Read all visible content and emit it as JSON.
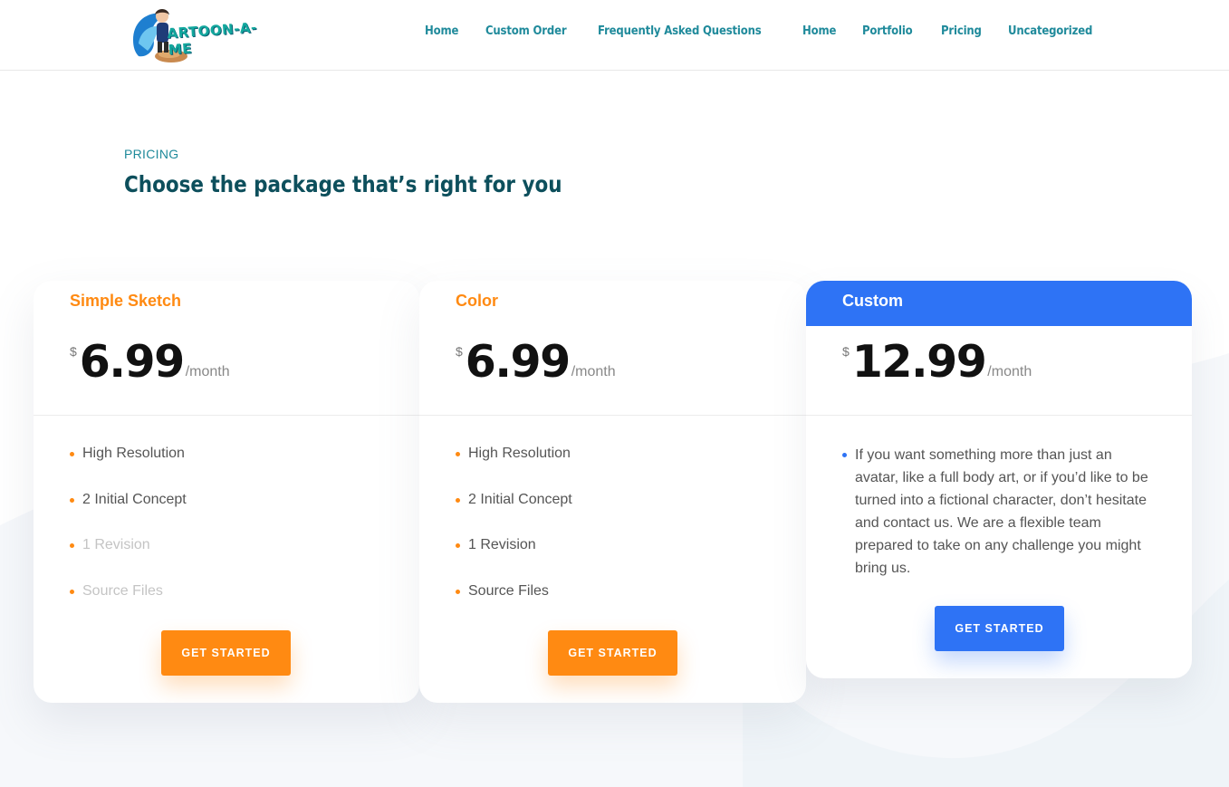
{
  "header": {
    "logo_text": "ARTOON-A-ME",
    "nav": [
      "Home",
      "Custom Order",
      "Frequently Asked Questions",
      "Home",
      "Portfolio",
      "Pricing",
      "Uncategorized"
    ]
  },
  "intro": {
    "eyebrow": "PRICING",
    "headline": "Choose the package that’s right for you"
  },
  "plans": [
    {
      "title": "Simple Sketch",
      "currency": "$",
      "amount": "6.99",
      "period": "/month",
      "features": [
        "High Resolution",
        "2 Initial Concept",
        "1 Revision",
        "Source Files"
      ],
      "button": "GET STARTED"
    },
    {
      "title": "Color",
      "currency": "$",
      "amount": "6.99",
      "period": "/month",
      "features": [
        "High Resolution",
        "2 Initial Concept",
        "1 Revision",
        "Source Files"
      ],
      "button": "GET STARTED"
    },
    {
      "title": "Custom",
      "currency": "$",
      "amount": "12.99",
      "period": "/month",
      "description": "If you want something more than just an avatar, like a full body art, or if you’d like to be turned into a fictional character, don’t hesitate and contact us. We are a flexible team prepared to take on any challenge you might bring us.",
      "button": "GET STARTED"
    }
  ],
  "colors": {
    "accent_orange": "#ff8a12",
    "accent_blue": "#2e73f5",
    "nav_teal": "#1f8a9b",
    "headline": "#0d4f5c"
  }
}
